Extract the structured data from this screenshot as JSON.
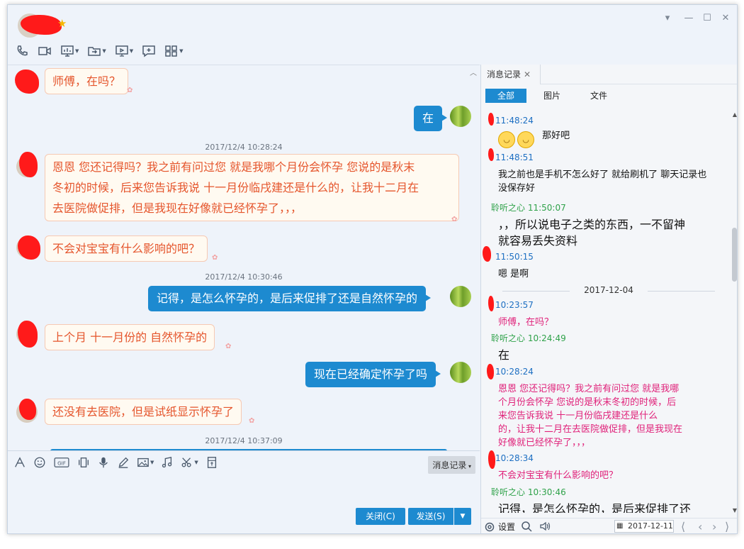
{
  "window": {
    "controls": [
      "▾",
      "—",
      "☐",
      "✕"
    ]
  },
  "chat": {
    "timestamps": [
      "2017/12/4 10:28:24",
      "2017/12/4 10:30:46",
      "2017/12/4 10:37:09"
    ],
    "messages": [
      {
        "side": "left",
        "text": "师傅，在吗？"
      },
      {
        "side": "right",
        "text": "在"
      },
      {
        "side": "left",
        "lines": [
          "恩恩  您还记得吗？我之前有问过您 就是我哪个月份会怀孕  您说的是秋末",
          "冬初的时候，后来您告诉我说  十一月份临戌建还是什么的，让我十二月在",
          "去医院做促排，但是我现在好像就已经怀孕了，，，"
        ]
      },
      {
        "side": "left",
        "text": "不会对宝宝有什么影响的吧？"
      },
      {
        "side": "right",
        "text": "记得，是怎么怀孕的，是后来促排了还是自然怀孕的"
      },
      {
        "side": "left",
        "text": "上个月  十一月份的  自然怀孕的"
      },
      {
        "side": "right",
        "text": "现在已经确定怀孕了吗"
      },
      {
        "side": "left",
        "text": "还没有去医院，但是试纸显示怀孕了"
      }
    ]
  },
  "input": {
    "history_button": "消息记录",
    "close_button": "关闭(C)",
    "send_button": "发送(S)"
  },
  "panel": {
    "tab_label": "消息记录",
    "filters": [
      "全部",
      "图片",
      "文件"
    ],
    "entries": {
      "t1": "11:48:24",
      "e1_text": "那好吧",
      "t2": "11:48:51",
      "e2_lines": [
        "我之前也是手机不怎么好了 就给刷机了  聊天记录也",
        "没保存好"
      ],
      "n3": "聆听之心 11:50:07",
      "e3_lines": [
        "，，所以说电子之类的东西，一不留神",
        "就容易丢失资料"
      ],
      "t4": "11:50:15",
      "e4_text": "嗯 是啊",
      "date_sep": "2017-12-04",
      "t5": "10:23:57",
      "e5_text": "师傅，在吗？",
      "n6": "聆听之心 10:24:49",
      "e6_text": "在",
      "t7": "10:28:24",
      "e7_lines": [
        "恩恩  您还记得吗？我之前有问过您 就是我哪",
        "个月份会怀孕  您说的是秋末冬初的时候，后",
        "来您告诉我说  十一月份临戌建还是什么",
        "的，让我十二月在去医院做促排，但是我现在",
        "好像就已经怀孕了，，，"
      ],
      "t8": "10:28:34",
      "e8_text": "不会对宝宝有什么影响的吧？",
      "n9": "聆听之心 10:30:46",
      "e9_text": "记得，是怎么怀孕的，是后来促排了还"
    },
    "bottom": {
      "settings_label": "设置",
      "date_value": "2017-12-11"
    }
  }
}
